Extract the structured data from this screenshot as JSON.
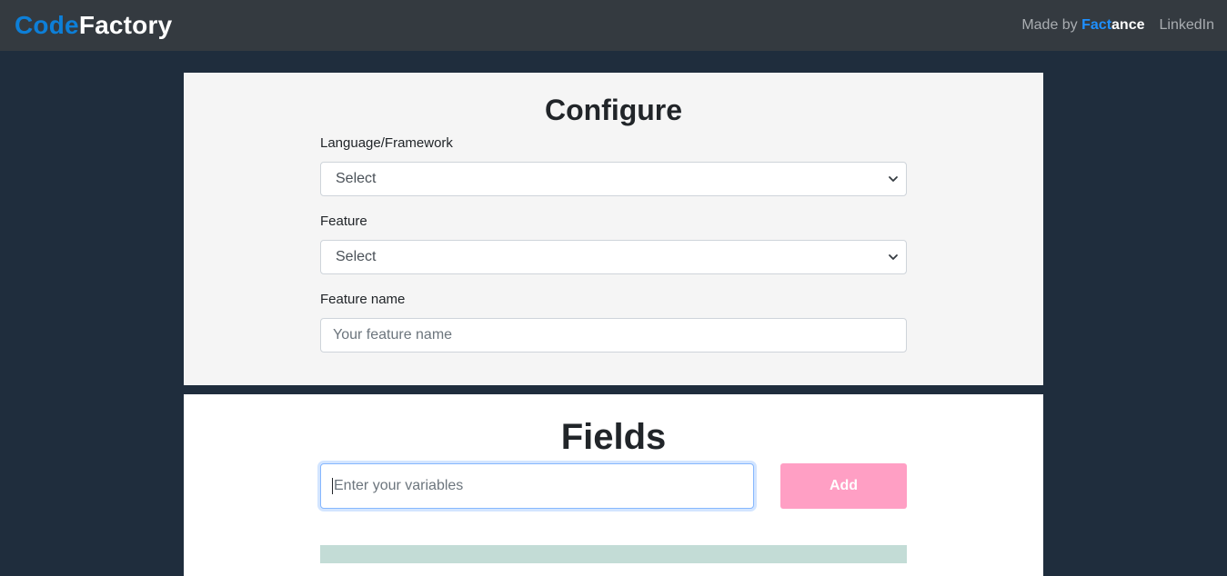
{
  "navbar": {
    "brand_part1": "Code",
    "brand_part2": "Factory",
    "made_by_prefix": "Made by ",
    "made_by_brand_part1": "Fact",
    "made_by_brand_part2": "ance",
    "linkedin_label": "LinkedIn"
  },
  "configure": {
    "title": "Configure",
    "language_label": "Language/Framework",
    "language_value": "Select",
    "feature_label": "Feature",
    "feature_value": "Select",
    "feature_name_label": "Feature name",
    "feature_name_placeholder": "Your feature name"
  },
  "fields": {
    "title": "Fields",
    "variables_placeholder": "Enter your variables",
    "add_label": "Add"
  },
  "colors": {
    "background": "#1f2d3d",
    "navbar": "#343a40",
    "brand_blue": "#0d7fd8",
    "add_button": "#ff9fc4",
    "strip": "#c3dcd6"
  },
  "icons": {
    "select_arrow": "chevron-down-icon"
  }
}
